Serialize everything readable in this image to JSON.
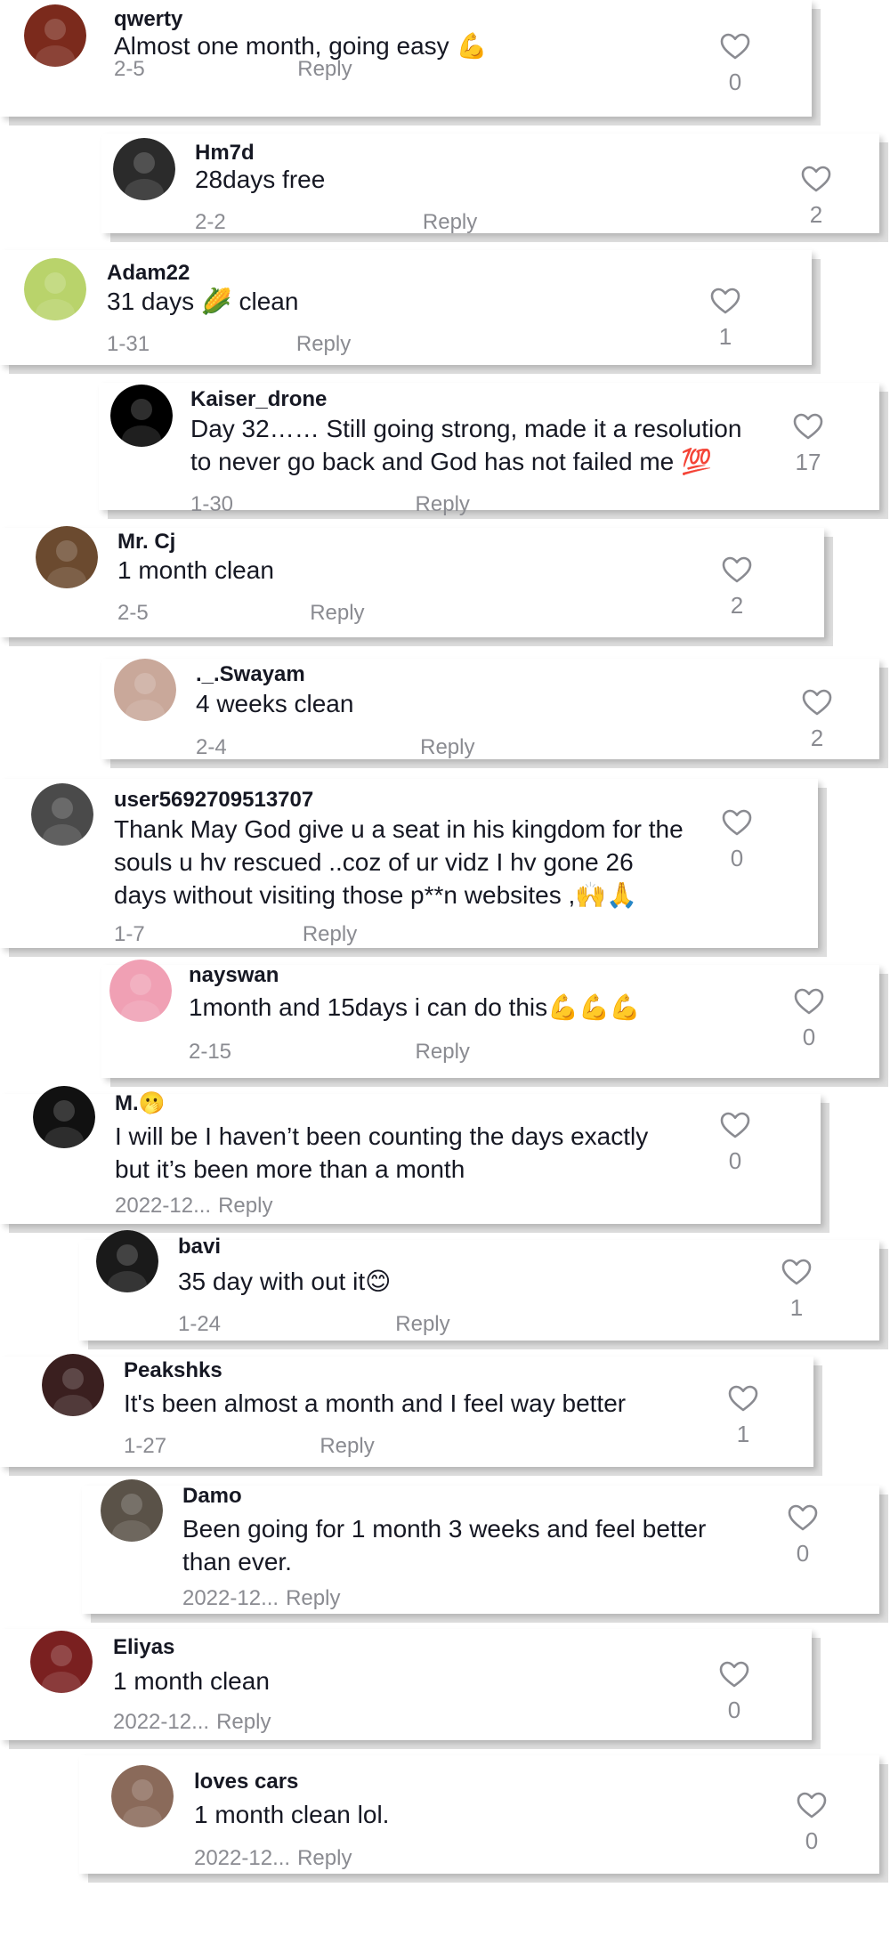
{
  "comments": [
    {
      "username": "qwerty",
      "lines": [
        "Almost one month, going easy 💪"
      ],
      "date": "2-5",
      "reply": "Reply",
      "likes": "0",
      "avatar_color": "#7b2a1c"
    },
    {
      "username": "Hm7d",
      "lines": [
        "28days free"
      ],
      "date": "2-2",
      "reply": "Reply",
      "likes": "2",
      "avatar_color": "#2b2b2b"
    },
    {
      "username": "Adam22",
      "lines": [
        "31 days 🌽 clean"
      ],
      "date": "1-31",
      "reply": "Reply",
      "likes": "1",
      "avatar_color": "#b9d36b"
    },
    {
      "username": "Kaiser_drone",
      "lines": [
        "Day 32…… Still going strong, made it a resolution",
        "to never go back and God has not failed me 💯"
      ],
      "date": "1-30",
      "reply": "Reply",
      "likes": "17",
      "avatar_color": "#000000"
    },
    {
      "username": "Mr. Cj",
      "lines": [
        "1 month clean"
      ],
      "date": "2-5",
      "reply": "Reply",
      "likes": "2",
      "avatar_color": "#6b4a2f"
    },
    {
      "username": "._.Swayam",
      "lines": [
        "4 weeks clean"
      ],
      "date": "2-4",
      "reply": "Reply",
      "likes": "2",
      "avatar_color": "#c9a89a"
    },
    {
      "username": "user5692709513707",
      "lines": [
        "Thank May God give u a seat in his kingdom for the",
        "souls u hv rescued ..coz of ur vidz I hv gone 26",
        "days without visiting those p**n websites ,🙌🙏"
      ],
      "date": "1-7",
      "reply": "Reply",
      "likes": "0",
      "avatar_color": "#4a4a4a"
    },
    {
      "username": "nayswan",
      "lines": [
        "1month and 15days i can do this💪💪💪"
      ],
      "date": "2-15",
      "reply": "Reply",
      "likes": "0",
      "avatar_color": "#f0a0b4"
    },
    {
      "username": "M.🫢",
      "lines": [
        "I will be I haven’t been counting the days exactly",
        "but it’s been more than a month"
      ],
      "date": "2022-12...",
      "reply": "Reply",
      "likes": "0",
      "avatar_color": "#111111"
    },
    {
      "username": "bavi",
      "lines": [
        "35 day with out it😊"
      ],
      "date": "1-24",
      "reply": "Reply",
      "likes": "1",
      "avatar_color": "#1a1a1a"
    },
    {
      "username": "Peakshks",
      "lines": [
        "It's been almost a month and I feel way better"
      ],
      "date": "1-27",
      "reply": "Reply",
      "likes": "1",
      "avatar_color": "#3a1f1f"
    },
    {
      "username": "Damo",
      "lines": [
        "Been going for 1 month 3 weeks and feel better",
        "than ever."
      ],
      "date": "2022-12...",
      "reply": "Reply",
      "likes": "0",
      "avatar_color": "#5a5248"
    },
    {
      "username": "Eliyas",
      "lines": [
        "1 month clean"
      ],
      "date": "2022-12...",
      "reply": "Reply",
      "likes": "0",
      "avatar_color": "#7a2020"
    },
    {
      "username": "loves cars",
      "lines": [
        "1 month clean lol."
      ],
      "date": "2022-12...",
      "reply": "Reply",
      "likes": "0",
      "avatar_color": "#8a6a5a"
    }
  ],
  "icons": {
    "like": "heart-outline-icon"
  }
}
